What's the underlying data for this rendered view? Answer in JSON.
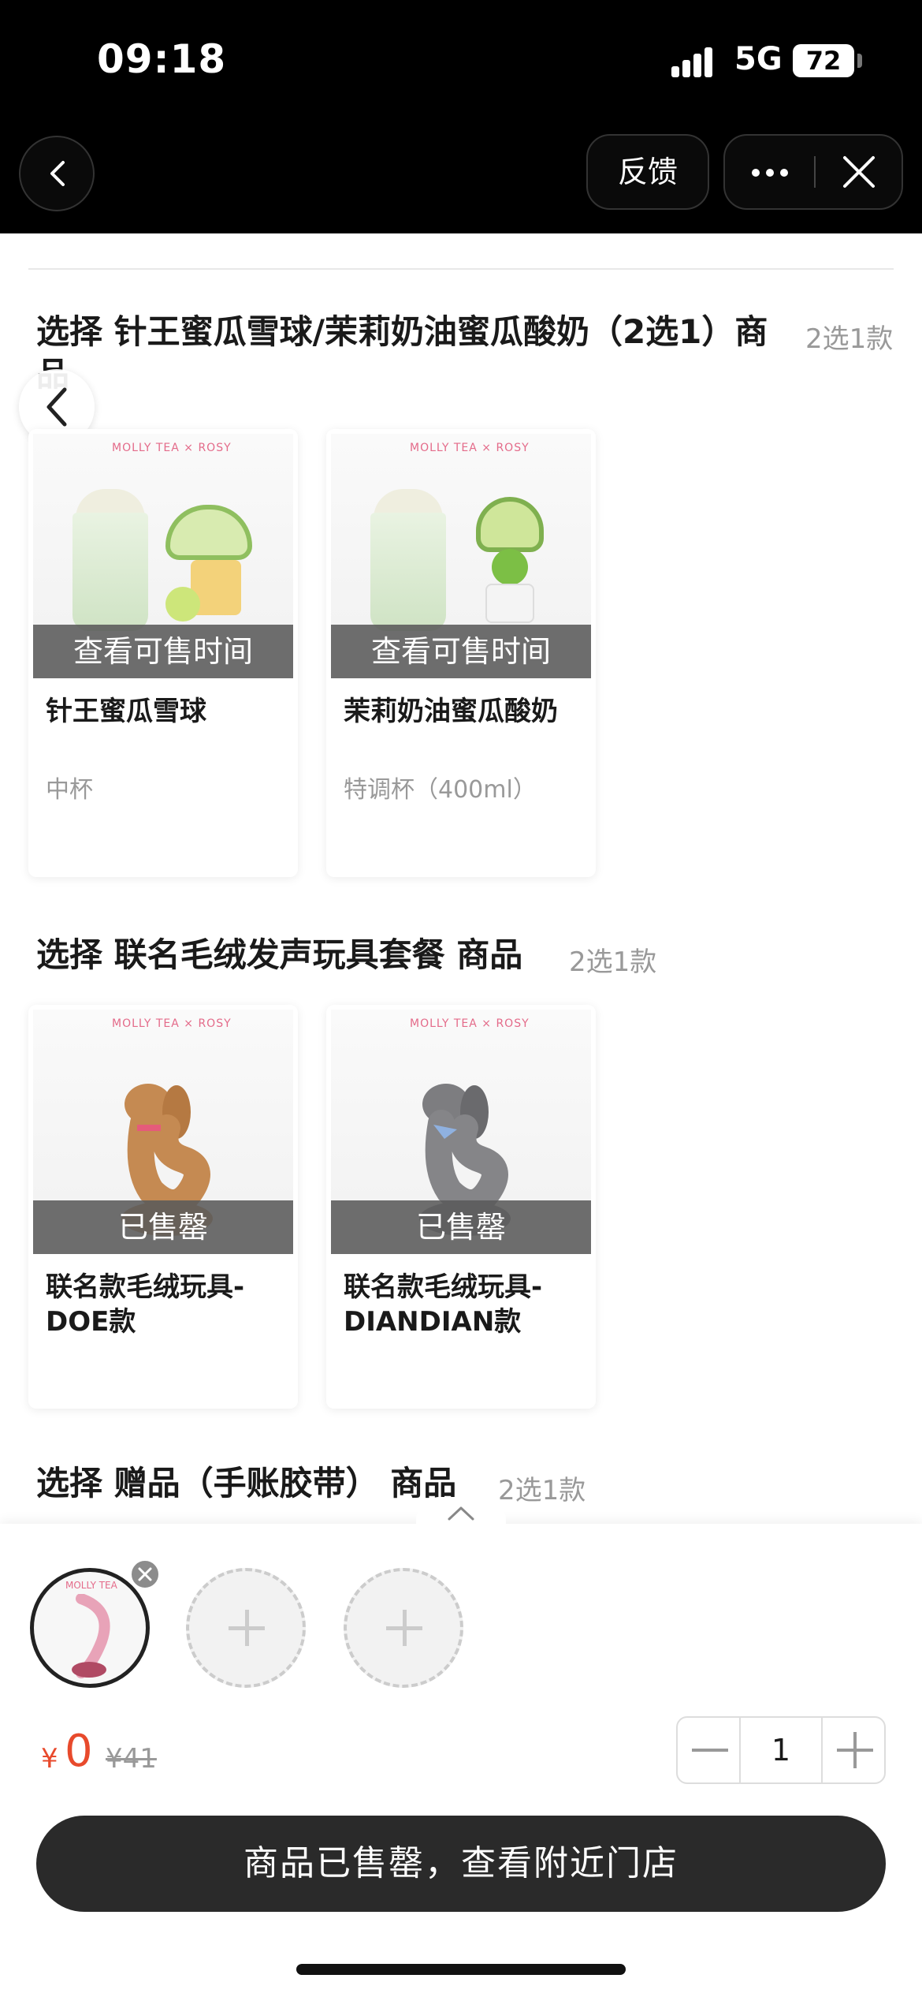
{
  "status_bar": {
    "time": "09:18",
    "network": "5G",
    "battery": "72"
  },
  "nav": {
    "feedback_label": "反馈"
  },
  "sections": [
    {
      "title": "选择 针王蜜瓜雪球/茉莉奶油蜜瓜酸奶（2选1）商品",
      "hint": "2选1款",
      "items": [
        {
          "name": "针王蜜瓜雪球",
          "spec": "中杯",
          "overlay": "查看可售时间",
          "brand": "MOLLY TEA × ROSY"
        },
        {
          "name": "茉莉奶油蜜瓜酸奶",
          "spec": "特调杯（400ml）",
          "overlay": "查看可售时间",
          "brand": "MOLLY TEA × ROSY"
        }
      ]
    },
    {
      "title": "选择 联名毛绒发声玩具套餐 商品",
      "hint": "2选1款",
      "items": [
        {
          "name": "联名款毛绒玩具-DOE款",
          "spec": "",
          "overlay": "已售罄",
          "brand": "MOLLY TEA × ROSY"
        },
        {
          "name": "联名款毛绒玩具-DIANDIAN款",
          "spec": "",
          "overlay": "已售罄",
          "brand": "MOLLY TEA × ROSY"
        }
      ]
    },
    {
      "title": "选择 赠品（手账胶带） 商品",
      "hint": "2选1款"
    }
  ],
  "bottom": {
    "currency": "¥",
    "price": "0",
    "original_price": "¥41",
    "quantity": "1",
    "cta_label": "商品已售罄，查看附近门店",
    "selected_brand": "MOLLY TEA"
  },
  "colors": {
    "price": "#e84a2c",
    "cta_bg": "#2a2a2a",
    "overlay": "#5a5a5a"
  },
  "icons": [
    "back-icon",
    "more-icon",
    "close-icon",
    "chevron-up-icon",
    "plus-icon",
    "minus-icon",
    "remove-icon"
  ]
}
